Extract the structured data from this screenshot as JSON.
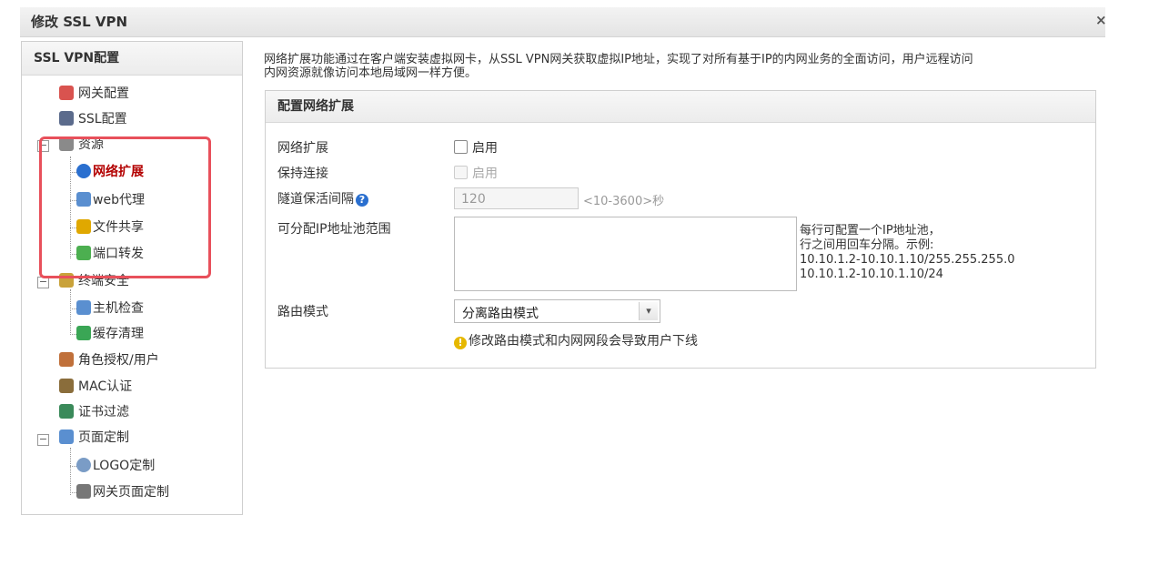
{
  "window": {
    "title": "修改 SSL VPN",
    "close_glyph": "×"
  },
  "sidebar": {
    "header": "SSL VPN配置",
    "items": [
      {
        "label": "网关配置",
        "icon": "gateway-config-icon",
        "color": "#d9534f"
      },
      {
        "label": "SSL配置",
        "icon": "ssl-config-icon",
        "color": "#5b6b8c"
      },
      {
        "label": "资源",
        "icon": "resource-icon",
        "color": "#8a8a8a",
        "toggle": "−"
      },
      {
        "label": "网络扩展",
        "icon": "network-extension-icon",
        "color": "#2a6fcf"
      },
      {
        "label": "web代理",
        "icon": "web-proxy-icon",
        "color": "#5a8fd0"
      },
      {
        "label": "文件共享",
        "icon": "file-share-icon",
        "color": "#e0a800"
      },
      {
        "label": "端口转发",
        "icon": "port-forward-icon",
        "color": "#4caf50"
      },
      {
        "label": "终端安全",
        "icon": "terminal-security-icon",
        "color": "#c9a23a",
        "toggle": "−"
      },
      {
        "label": "主机检查",
        "icon": "host-check-icon",
        "color": "#5a8fd0"
      },
      {
        "label": "缓存清理",
        "icon": "cache-clean-icon",
        "color": "#3aa655"
      },
      {
        "label": "角色授权/用户",
        "icon": "role-user-icon",
        "color": "#c0703a"
      },
      {
        "label": "MAC认证",
        "icon": "mac-auth-icon",
        "color": "#8a6d3b"
      },
      {
        "label": "证书过滤",
        "icon": "cert-filter-icon",
        "color": "#3a8a5a"
      },
      {
        "label": "页面定制",
        "icon": "page-custom-icon",
        "color": "#5a8fd0",
        "toggle": "−"
      },
      {
        "label": "LOGO定制",
        "icon": "logo-custom-icon",
        "color": "#7a9cc6"
      },
      {
        "label": "网关页面定制",
        "icon": "gateway-page-icon",
        "color": "#777777"
      }
    ]
  },
  "main": {
    "description_line1": "网络扩展功能通过在客户端安装虚拟网卡，从SSL VPN网关获取虚拟IP地址，实现了对所有基于IP的内网业务的全面访问，用户远程访问",
    "description_line2": "内网资源就像访问本地局域网一样方便。",
    "panel_title": "配置网络扩展",
    "network_extension_label": "网络扩展",
    "network_extension_checkbox": "启用",
    "keepalive_label": "保持连接",
    "keepalive_checkbox": "启用",
    "tunnel_interval_label": "隧道保活间隔",
    "tunnel_interval_help": "?",
    "tunnel_interval_value": "120",
    "tunnel_interval_hint": "<10-3600>秒",
    "ip_pool_label": "可分配IP地址池范围",
    "ip_pool_value": "",
    "ip_pool_example": [
      "每行可配置一个IP地址池，",
      "行之间用回车分隔。示例:",
      "10.10.1.2-10.10.1.10/255.255.255.0",
      "10.10.1.2-10.10.1.10/24"
    ],
    "route_mode_label": "路由模式",
    "route_mode_selected": "分离路由模式",
    "route_mode_arrow": "▾",
    "route_warning": "修改路由模式和内网网段会导致用户下线",
    "warning_glyph": "!"
  },
  "colors": {
    "highlight": "#e8505b",
    "active_text": "#b30000"
  }
}
